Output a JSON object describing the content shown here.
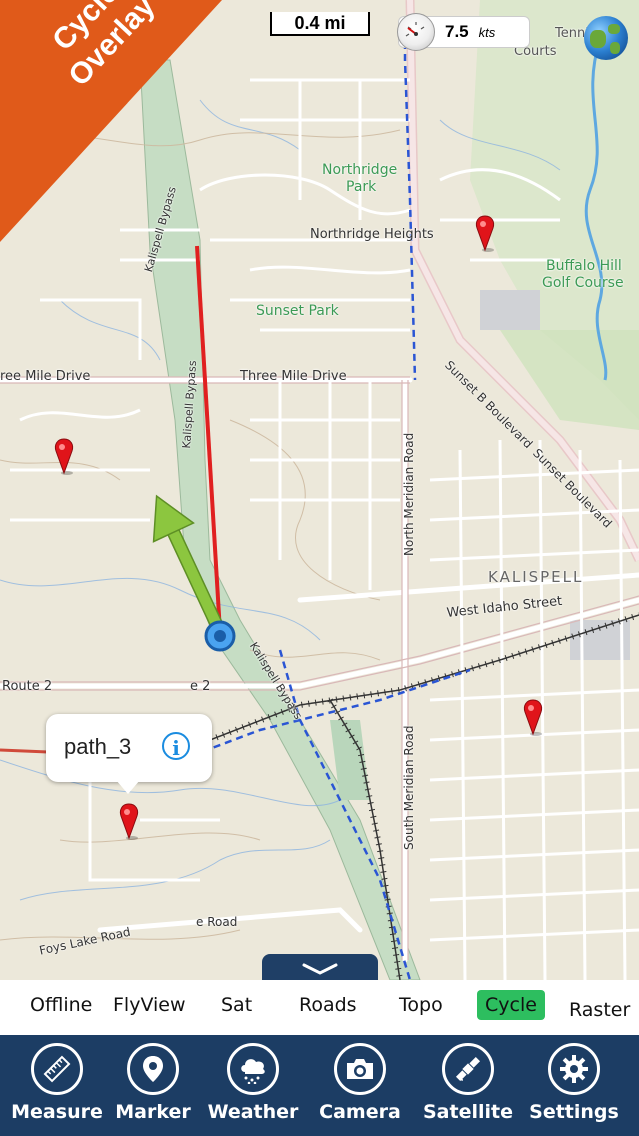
{
  "overlay_badge": {
    "label_line1": "Cycle",
    "label_line2": "Overlay",
    "color": "#e05a1a"
  },
  "scale": {
    "label": "0.4 mi"
  },
  "speed": {
    "value": "7.5",
    "unit": "kts"
  },
  "map_labels": {
    "tennis_courts_1": "Tennis",
    "tennis_courts_2": "Courts",
    "northridge_park_1": "Northridge",
    "northridge_park_2": "Park",
    "northridge_heights": "Northridge Heights",
    "buffalo_hill_1": "Buffalo Hill",
    "buffalo_hill_2": "Golf Course",
    "sunset_park": "Sunset Park",
    "three_mile_drive_left": "ree Mile Drive",
    "three_mile_drive": "Three Mile Drive",
    "kalispell_bypass_top": "Kalispell Bypass",
    "kalispell_bypass_mid": "Kalispell Bypass",
    "kalispell_bypass_low": "Kalispell Bypass",
    "north_meridian": "North Meridian Road",
    "south_meridian": "South Meridian Road",
    "sunset_boulevard": "Sunset B Boulevard",
    "sunset_boulevard_2": "Sunset Boulevard",
    "kalispell": "KALISPELL",
    "west_idaho": "West Idaho Street",
    "route2_left": "Route 2",
    "route2_mid": "e 2",
    "foys_lake": "Foys Lake Road",
    "foys_lake_2": "e Road"
  },
  "popup": {
    "title": "path_3"
  },
  "layers": {
    "items": [
      "Offline",
      "FlyView",
      "Sat",
      "Roads",
      "Topo",
      "Cycle",
      "Raster"
    ],
    "active": "Cycle"
  },
  "toolbar": {
    "items": [
      {
        "label": "Measure",
        "icon": "ruler-icon"
      },
      {
        "label": "Marker",
        "icon": "location-pin-icon"
      },
      {
        "label": "Weather",
        "icon": "cloud-rain-icon"
      },
      {
        "label": "Camera",
        "icon": "camera-icon"
      },
      {
        "label": "Satellite",
        "icon": "satellite-icon"
      },
      {
        "label": "Settings",
        "icon": "gear-icon"
      }
    ]
  },
  "colors": {
    "toolbar_bg": "#1c3d64",
    "active_layer": "#2dbe5f",
    "track_line": "#e02020",
    "heading_arrow": "#8cc63f"
  }
}
